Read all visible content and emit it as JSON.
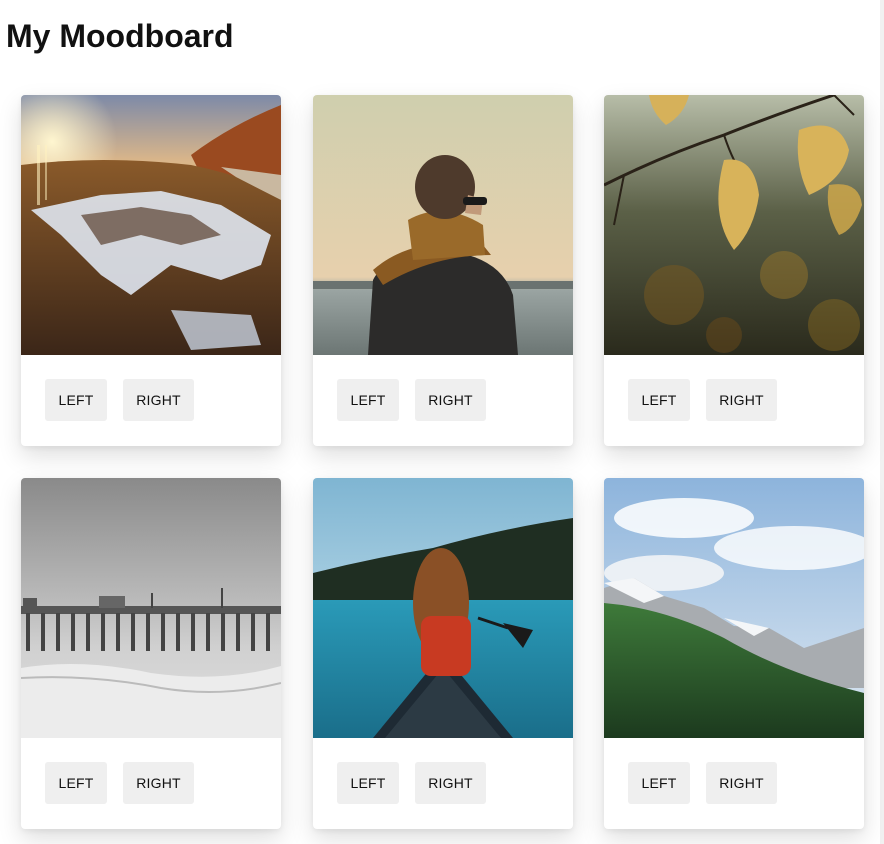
{
  "page": {
    "title": "My Moodboard"
  },
  "cards": [
    {
      "left_label": "LEFT",
      "right_label": "RIGHT"
    },
    {
      "left_label": "LEFT",
      "right_label": "RIGHT"
    },
    {
      "left_label": "LEFT",
      "right_label": "RIGHT"
    },
    {
      "left_label": "LEFT",
      "right_label": "RIGHT"
    },
    {
      "left_label": "LEFT",
      "right_label": "RIGHT"
    },
    {
      "left_label": "LEFT",
      "right_label": "RIGHT"
    }
  ]
}
